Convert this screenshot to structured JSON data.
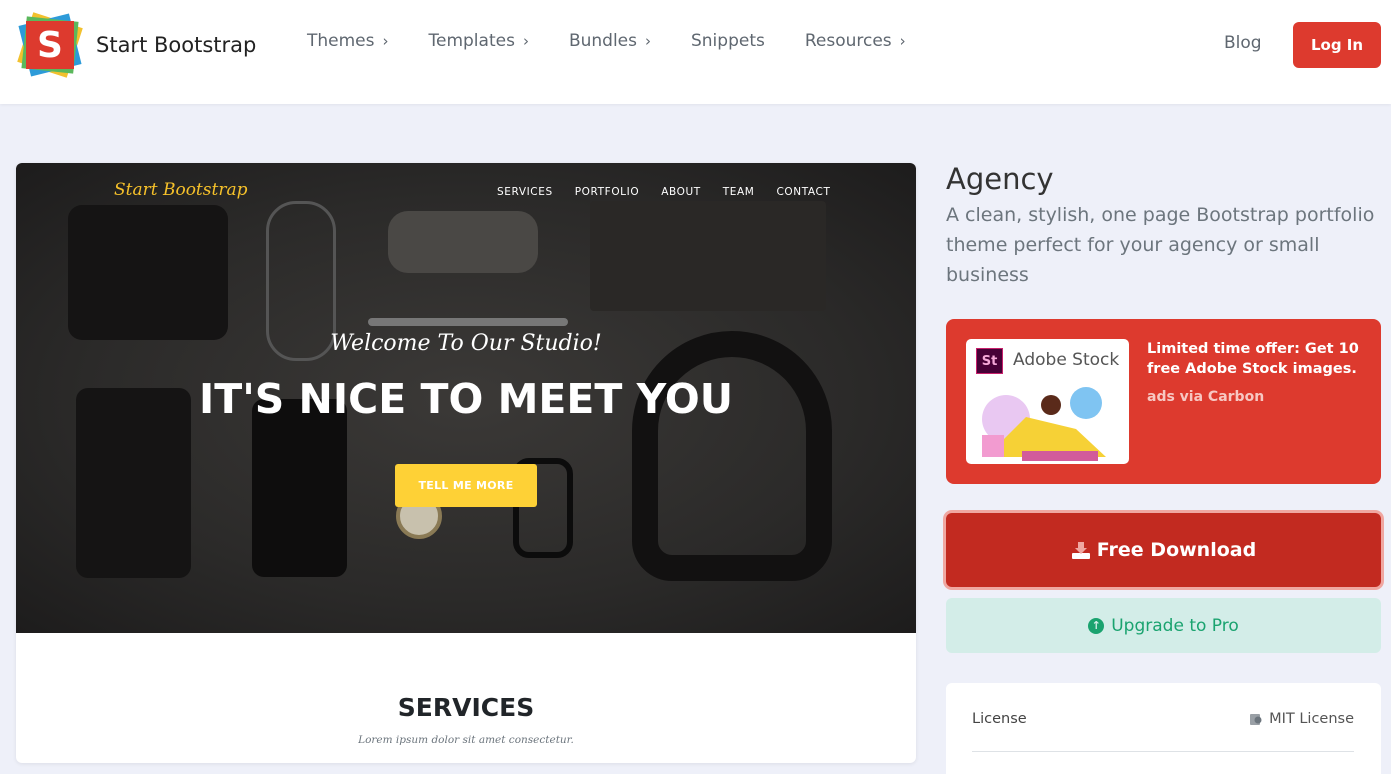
{
  "navbar": {
    "brand_letter": "S",
    "brand_name": "Start Bootstrap",
    "links": [
      {
        "label": "Themes",
        "chevron": true
      },
      {
        "label": "Templates",
        "chevron": true
      },
      {
        "label": "Bundles",
        "chevron": true
      },
      {
        "label": "Snippets",
        "chevron": false
      },
      {
        "label": "Resources",
        "chevron": true
      }
    ],
    "blog_label": "Blog",
    "login_label": "Log In"
  },
  "preview": {
    "brand": "Start Bootstrap",
    "nav": [
      "SERVICES",
      "PORTFOLIO",
      "ABOUT",
      "TEAM",
      "CONTACT"
    ],
    "subheading": "Welcome To Our Studio!",
    "heading": "IT'S NICE TO MEET YOU",
    "button": "TELL ME MORE",
    "section_title": "SERVICES",
    "section_subtitle": "Lorem ipsum dolor sit amet consectetur."
  },
  "theme": {
    "title": "Agency",
    "description": "A clean, stylish, one page Bootstrap portfolio theme perfect for your agency or small business"
  },
  "ad": {
    "logo_text": "St",
    "product_name": "Adobe Stock",
    "text": "Limited time offer: Get 10 free Adobe Stock images.",
    "via": "ads via Carbon"
  },
  "actions": {
    "download_label": "Free Download",
    "upgrade_label": "Upgrade to Pro"
  },
  "info": {
    "license_label": "License",
    "license_value": "MIT License"
  },
  "colors": {
    "brand_red": "#dd3a2e",
    "download_red": "#c22a20",
    "pro_green": "#1aa36f",
    "hero_yellow": "#fed136",
    "page_bg": "#eef0f9"
  },
  "icons": [
    "chevron-right-icon",
    "download-icon",
    "arrow-up-circle-icon",
    "license-icon"
  ]
}
